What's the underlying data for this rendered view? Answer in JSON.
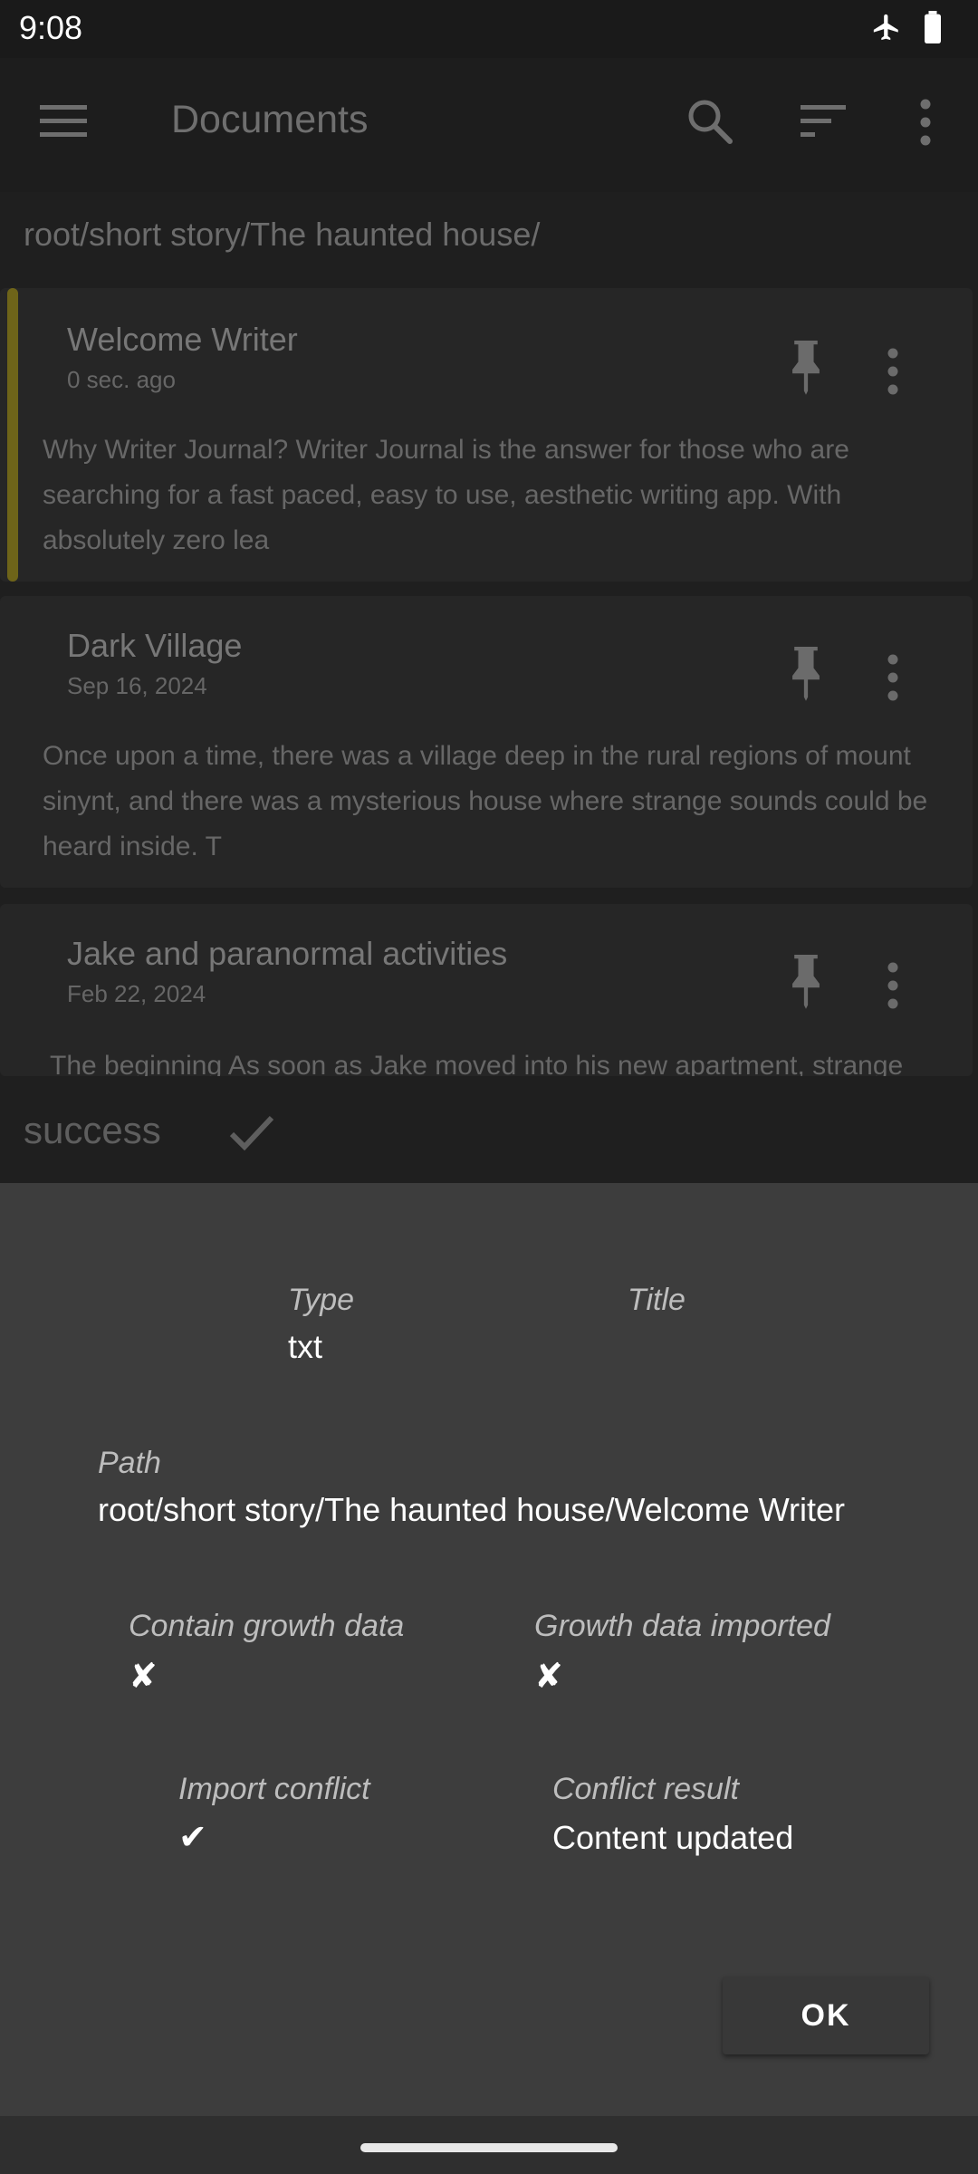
{
  "status_bar": {
    "time": "9:08",
    "icons": [
      "airplane-mode-icon",
      "battery-icon"
    ]
  },
  "app_bar": {
    "title": "Documents",
    "actions": [
      "menu-icon",
      "search-icon",
      "sort-icon",
      "more-vert-icon"
    ]
  },
  "breadcrumb": "root/short story/The haunted house/",
  "documents": [
    {
      "title": "Welcome Writer",
      "date": "0 sec. ago",
      "preview_lines": [
        "Why Writer Journal? Writer Journal is the answer for those who are",
        "searching for a fast paced, easy to use, aesthetic writing app. With",
        "absolutely zero lea"
      ]
    },
    {
      "title": "Dark Village",
      "date": "Sep 16, 2024",
      "preview_lines": [
        "Once upon a time, there was a village deep in the rural regions of mount",
        "sinynt, and there was a mysterious house where strange sounds could be",
        "heard inside. T"
      ]
    },
    {
      "title": "Jake and paranormal activities",
      "date": "Feb 22, 2024",
      "preview_lines": [
        "The beginning As soon as Jake moved into his new apartment, strange"
      ]
    }
  ],
  "snackbar": {
    "text": "success"
  },
  "dialog": {
    "type_label": "Type",
    "type_value": "txt",
    "title_label": "Title",
    "title_value": "",
    "path_label": "Path",
    "path_value": "root/short story/The haunted house/Welcome Writer",
    "growth_data_label": "Contain growth data",
    "growth_data_value": "✘",
    "growth_imported_label": "Growth data imported",
    "growth_imported_value": "✘",
    "conflict_label": "Import conflict",
    "conflict_value": "✔",
    "conflict_result_label": "Conflict result",
    "conflict_result_value": "Content updated",
    "ok_label": "OK"
  },
  "colors": {
    "accent_stripe": "#6e6419",
    "dialog_bg": "#3d3d3d",
    "scrim_bg": "#1f1f1f"
  }
}
